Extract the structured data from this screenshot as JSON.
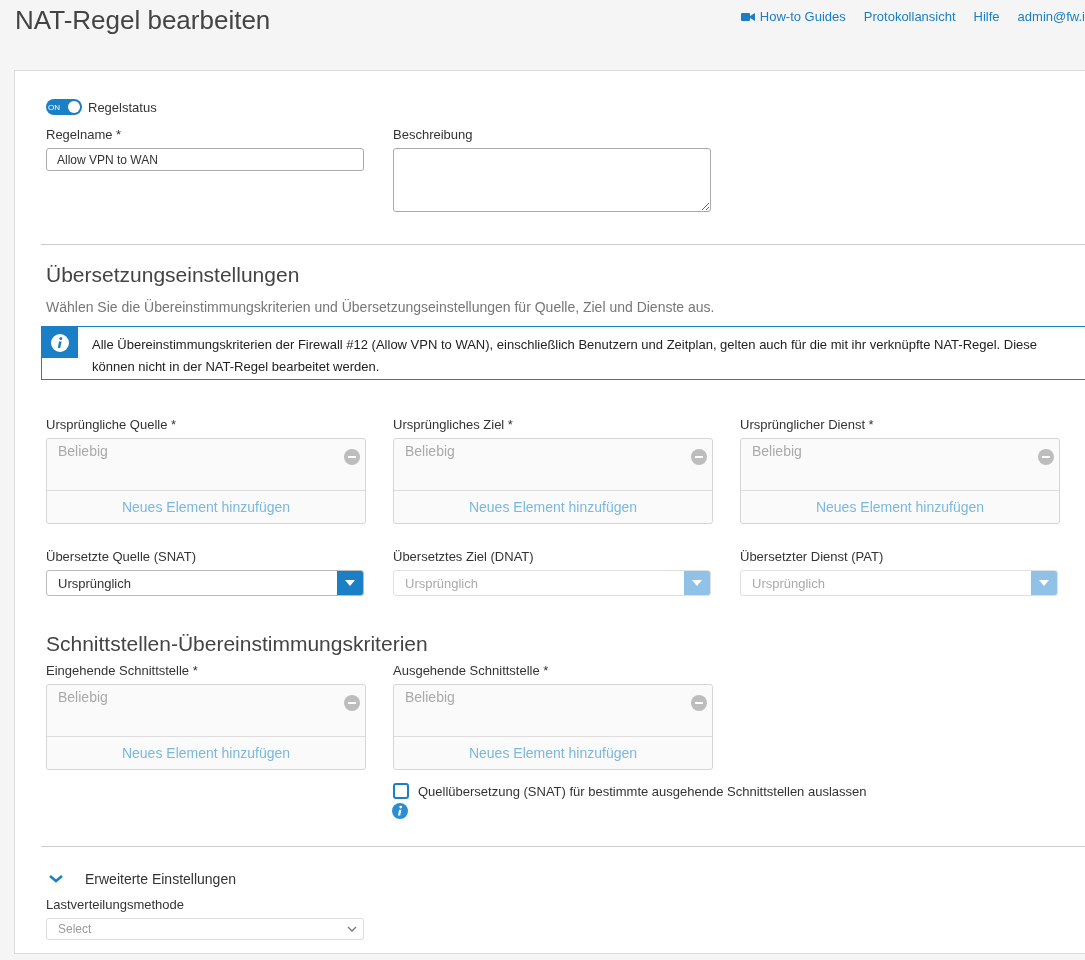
{
  "page_title": "NAT-Regel bearbeiten",
  "top_links": [
    {
      "kind": "video",
      "label": "How-to Guides"
    },
    {
      "kind": "plain",
      "label": "Protokollansicht"
    },
    {
      "kind": "plain",
      "label": "Hilfe"
    },
    {
      "kind": "plain",
      "label": "admin@fw.i"
    }
  ],
  "rule_status": {
    "label": "Regelstatus",
    "toggle_text": "ON",
    "on": true
  },
  "rule_name": {
    "label": "Regelname *",
    "value": "Allow VPN to WAN"
  },
  "description": {
    "label": "Beschreibung"
  },
  "translation": {
    "heading": "Übersetzungseinstellungen",
    "subtitle": "Wählen Sie die Übereinstimmungskriterien und Übersetzungseinstellungen für Quelle, Ziel und Dienste aus.",
    "info": "Alle Übereinstimmungskriterien der Firewall #12 (Allow VPN to WAN), einschließlich Benutzern und Zeitplan, gelten auch für die mit ihr verknüpfte NAT-Regel. Diese können nicht in der NAT-Regel bearbeitet werden.",
    "original": [
      {
        "label": "Ursprüngliche Quelle *",
        "placeholder": "Beliebig",
        "add_label": "Neues Element hinzufügen"
      },
      {
        "label": "Ursprüngliches Ziel *",
        "placeholder": "Beliebig",
        "add_label": "Neues Element hinzufügen"
      },
      {
        "label": "Ursprünglicher Dienst *",
        "placeholder": "Beliebig",
        "add_label": "Neues Element hinzufügen"
      }
    ],
    "translated": [
      {
        "label": "Übersetzte Quelle (SNAT)",
        "value": "Ursprünglich",
        "disabled": false
      },
      {
        "label": "Übersetztes Ziel (DNAT)",
        "value": "Ursprünglich",
        "disabled": true
      },
      {
        "label": "Übersetzter Dienst (PAT)",
        "value": "Ursprünglich",
        "disabled": true
      }
    ]
  },
  "interfaces": {
    "heading": "Schnittstellen-Übereinstimmungskriterien",
    "lists": [
      {
        "label": "Eingehende Schnittstelle *",
        "placeholder": "Beliebig",
        "add_label": "Neues Element hinzufügen"
      },
      {
        "label": "Ausgehende Schnittstelle *",
        "placeholder": "Beliebig",
        "add_label": "Neues Element hinzufügen"
      }
    ],
    "exclude_snat": {
      "label": "Quellübersetzung (SNAT) für bestimmte ausgehende Schnittstellen auslassen",
      "checked": false
    }
  },
  "advanced": {
    "label": "Erweiterte Einstellungen",
    "expanded": true,
    "load_balancing": {
      "label": "Lastverteilungsmethode",
      "placeholder": "Select"
    }
  }
}
